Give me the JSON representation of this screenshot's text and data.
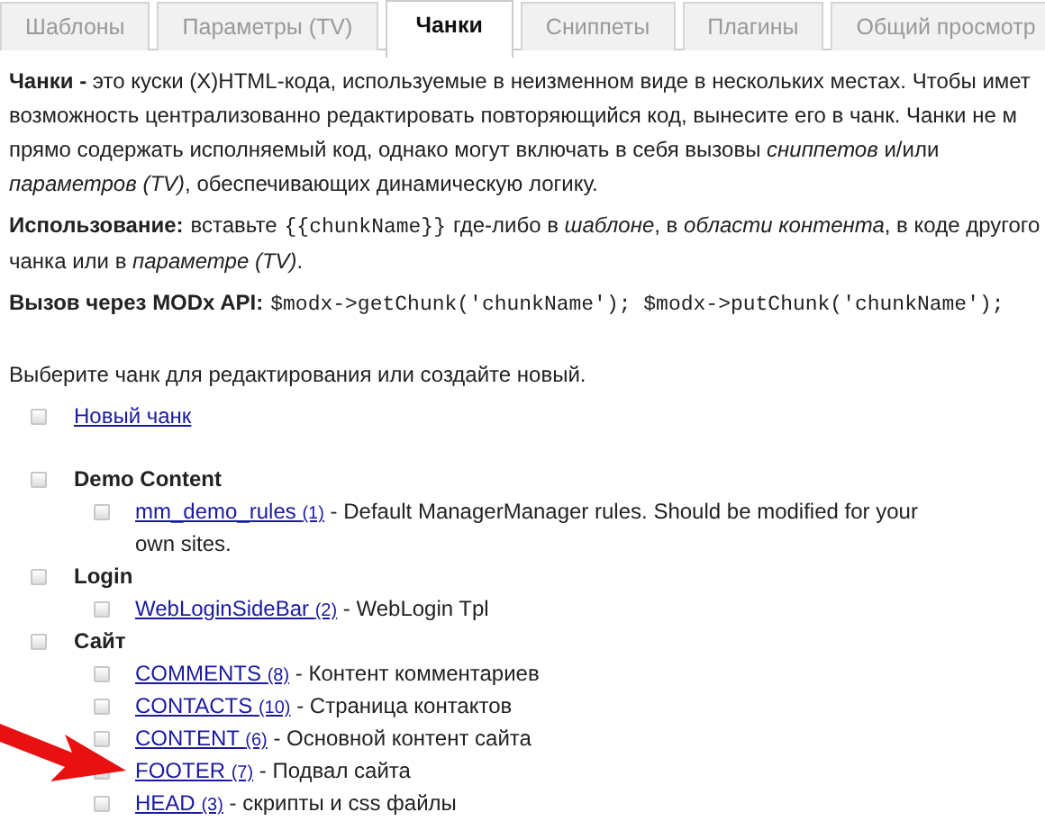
{
  "tabs": [
    {
      "label": "Шаблоны",
      "selected": false
    },
    {
      "label": "Параметры (TV)",
      "selected": false
    },
    {
      "label": "Чанки",
      "selected": true
    },
    {
      "label": "Сниппеты",
      "selected": false
    },
    {
      "label": "Плагины",
      "selected": false
    },
    {
      "label": "Общий просмотр",
      "selected": false
    }
  ],
  "intro_lines": [
    "**Чанки -** это куски (X)HTML-кода, используемые в неизменном виде в нескольких местах. Чтобы имет",
    "возможность централизованно редактировать повторяющийся код, вынесите его в чанк. Чанки не м",
    "прямо содержать исполняемый код, однако могут включать в себя вызовы *сниппетов* и/или",
    "*параметров (TV)*, обеспечивающих динамическую логику."
  ],
  "usage": {
    "label": "Использование:",
    "before": "вставьте",
    "code": "{{chunkName}}",
    "after": "где-либо в *шаблоне*, в *области контента*, в коде другого",
    "line2": "чанка или в *параметре (TV)*."
  },
  "api": {
    "label": "Вызов через MODx API:",
    "code": "$modx->getChunk('chunkName'); $modx->putChunk('chunkName');"
  },
  "prompt": "Выберите чанк для редактирования или создайте новый.",
  "new_chunk": "Новый чанк",
  "groups": [
    {
      "name": "Demo Content",
      "children": [
        {
          "name": "mm_demo_rules",
          "count": "(1)",
          "description": "- Default ManagerManager rules. Should be modified for your own sites."
        }
      ]
    },
    {
      "name": "Login",
      "children": [
        {
          "name": "WebLoginSideBar",
          "count": "(2)",
          "description": "- WebLogin Tpl"
        }
      ]
    },
    {
      "name": "Сайт",
      "children": [
        {
          "name": "COMMENTS",
          "count": "(8)",
          "description": "- Контент комментариев"
        },
        {
          "name": "CONTACTS",
          "count": "(10)",
          "description": "- Страница контактов"
        },
        {
          "name": "CONTENT",
          "count": "(6)",
          "description": "- Основной контент сайта"
        },
        {
          "name": "FOOTER",
          "count": "(7)",
          "description": "- Подвал сайта"
        },
        {
          "name": "HEAD",
          "count": "(3)",
          "description": "- скрипты и css файлы"
        }
      ]
    }
  ]
}
